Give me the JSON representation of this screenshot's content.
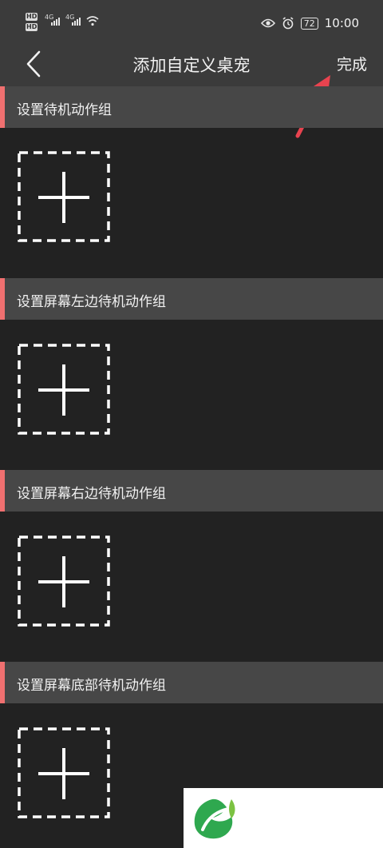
{
  "status_bar": {
    "hd_label": "HD",
    "network_label": "4G",
    "battery": "72",
    "time": "10:00",
    "icons": [
      "hd-icon",
      "signal-icon",
      "wifi-icon",
      "eye-icon",
      "alarm-icon",
      "battery-icon"
    ]
  },
  "nav": {
    "title": "添加自定义桌宠",
    "done_label": "完成"
  },
  "sections": [
    {
      "label": "设置待机动作组"
    },
    {
      "label": "设置屏幕左边待机动作组"
    },
    {
      "label": "设置屏幕右边待机动作组"
    },
    {
      "label": "设置屏幕底部待机动作组"
    }
  ],
  "colors": {
    "background": "#222222",
    "bars": "#3b3b3b",
    "section_header": "#474747",
    "accent": "#f07070",
    "annotation_arrow": "#e8434f",
    "logo_green": "#2fa84f"
  }
}
